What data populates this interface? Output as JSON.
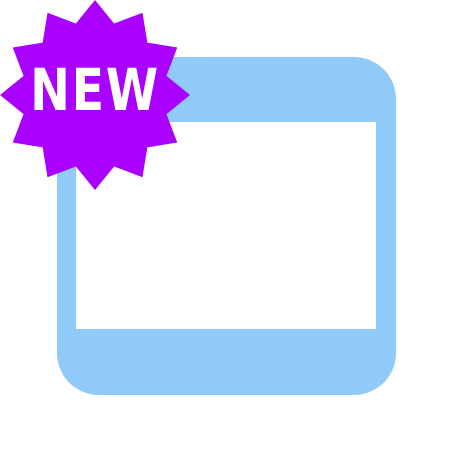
{
  "icon": {
    "name": "new-window-icon",
    "frame_color": "#90CAF9",
    "content_color": "#FFFFFF"
  },
  "badge": {
    "label": "NEW",
    "color": "#AA00FF",
    "label_color": "#FFFFFF"
  }
}
